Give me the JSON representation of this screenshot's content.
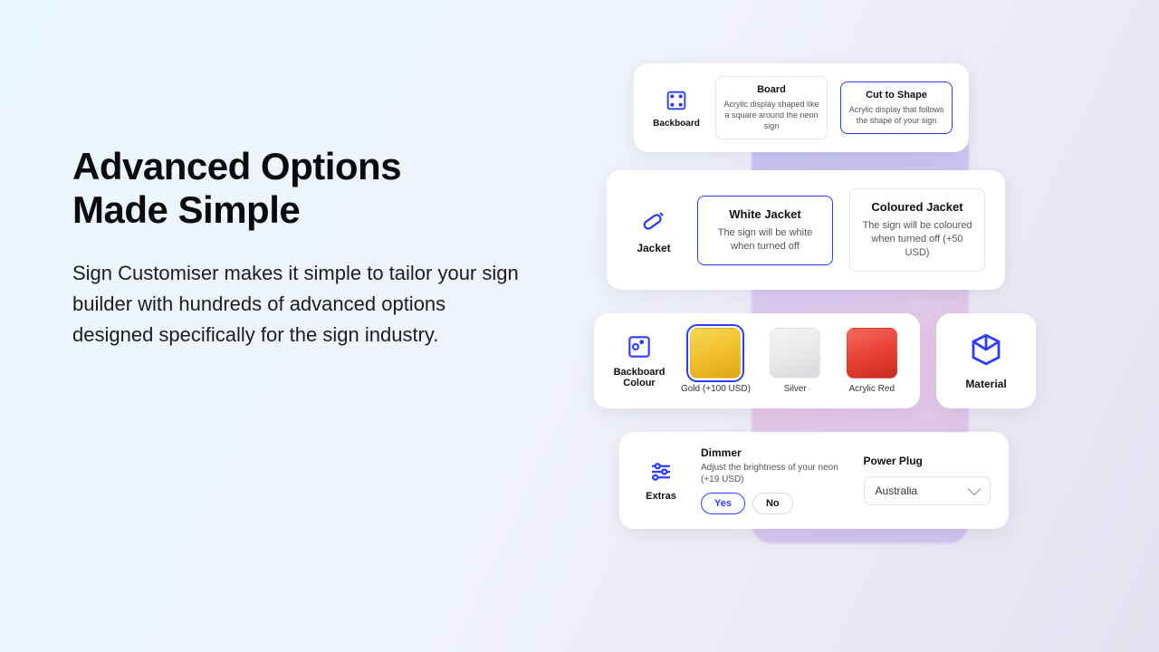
{
  "hero": {
    "title_l1": "Advanced Options",
    "title_l2": "Made Simple",
    "body": "Sign Customiser makes it simple to tailor your sign builder with hundreds of advanced options designed specifically for the sign industry."
  },
  "backboard": {
    "label": "Backboard",
    "options": [
      {
        "title": "Board",
        "desc": "Acrylic display shaped like a square around the neon sign",
        "selected": false
      },
      {
        "title": "Cut to Shape",
        "desc": "Acrylic display that follows the shape of your sign",
        "selected": true
      }
    ]
  },
  "jacket": {
    "label": "Jacket",
    "options": [
      {
        "title": "White Jacket",
        "desc": "The sign will be white when turned off",
        "selected": true
      },
      {
        "title": "Coloured Jacket",
        "desc": "The sign will be coloured when turned off (+50 USD)",
        "selected": false
      }
    ]
  },
  "backboard_colour": {
    "label": "Backboard Colour",
    "swatches": [
      {
        "name": "Gold (+100 USD)",
        "selected": true
      },
      {
        "name": "Silver",
        "selected": false
      },
      {
        "name": "Acrylic Red",
        "selected": false
      }
    ]
  },
  "material": {
    "label": "Material"
  },
  "extras": {
    "label": "Extras",
    "dimmer": {
      "title": "Dimmer",
      "desc": "Adjust the brightness of your neon (+19 USD)",
      "yes": "Yes",
      "no": "No",
      "selected": "Yes"
    },
    "plug": {
      "title": "Power Plug",
      "value": "Australia"
    }
  }
}
